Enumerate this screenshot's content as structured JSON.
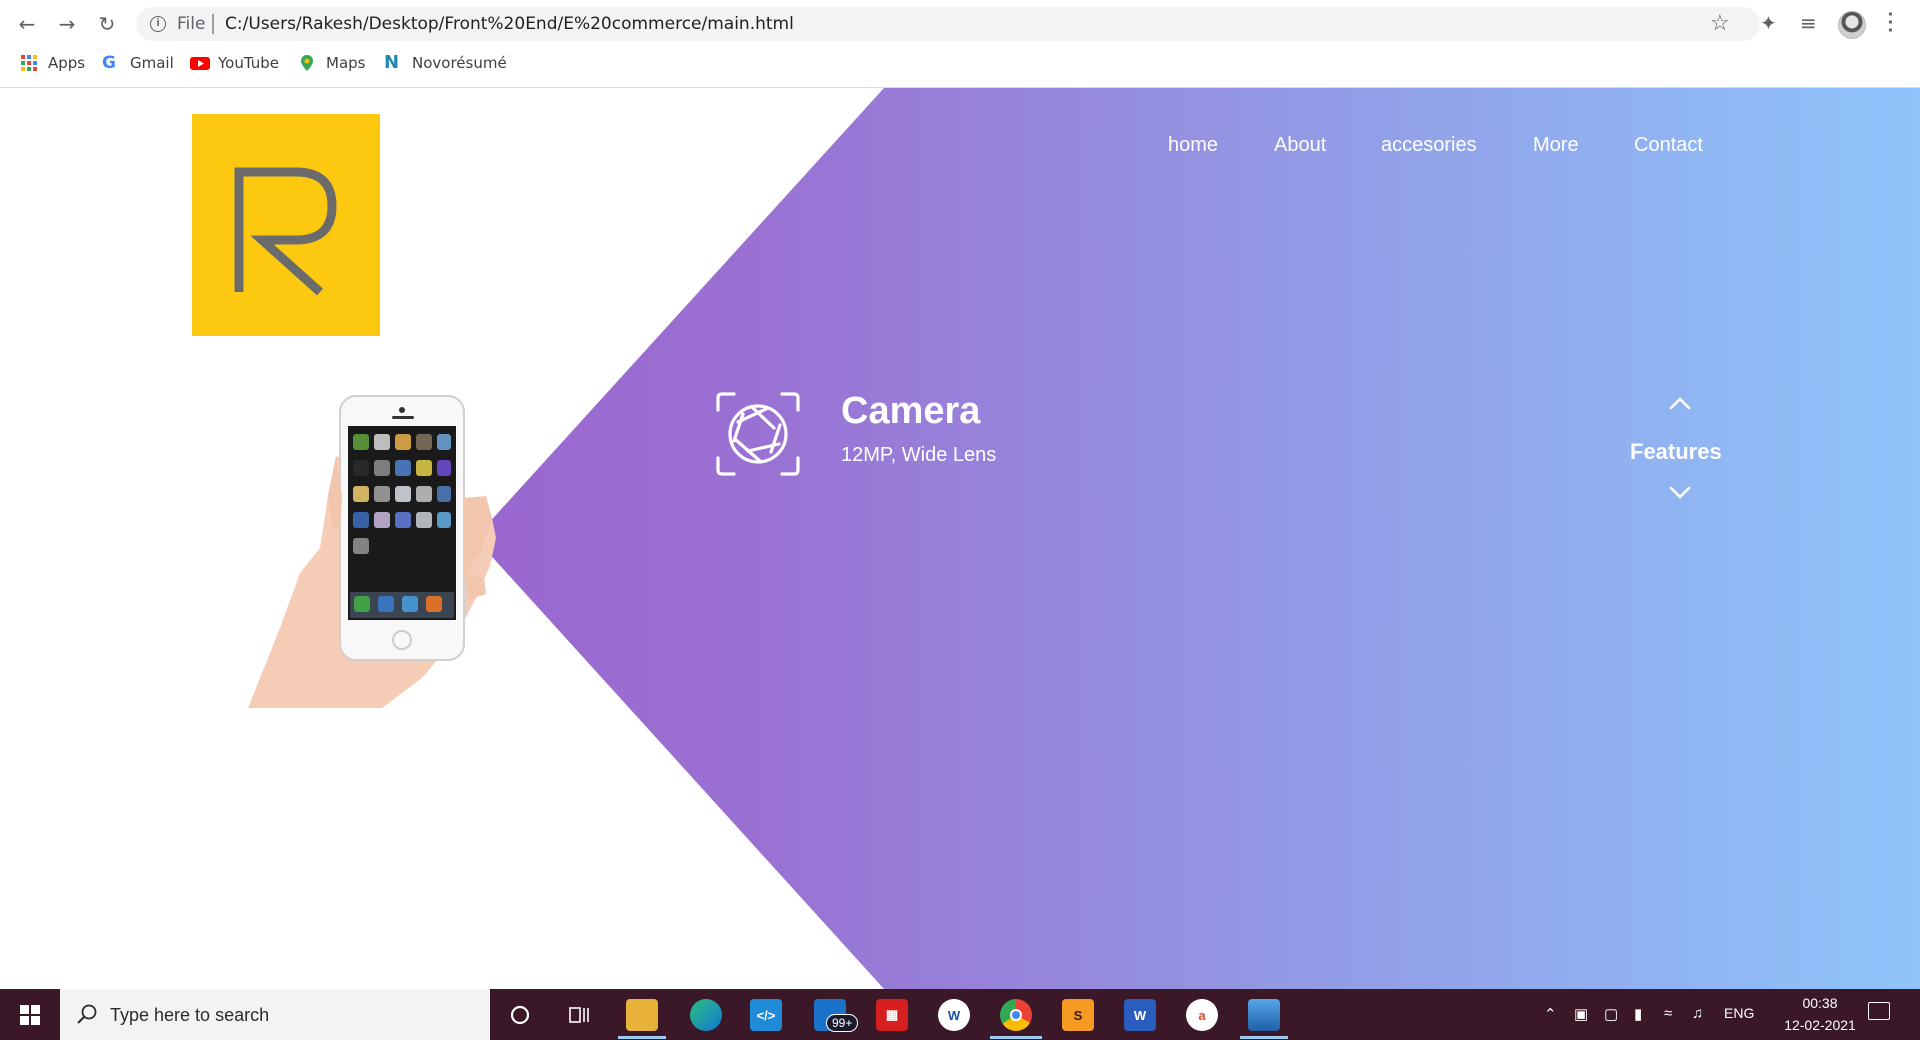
{
  "browser": {
    "file_label": "File",
    "url": "C:/Users/Rakesh/Desktop/Front%20End/E%20commerce/main.html",
    "bookmarks": [
      {
        "label": "Apps",
        "icon": "apps-grid-icon"
      },
      {
        "label": "Gmail",
        "icon": "google-icon"
      },
      {
        "label": "YouTube",
        "icon": "youtube-icon"
      },
      {
        "label": "Maps",
        "icon": "maps-pin-icon"
      },
      {
        "label": "Novorésumé",
        "icon": "novoresume-icon"
      }
    ]
  },
  "site": {
    "brand_color": "#fcc910",
    "nav": [
      "home",
      "About",
      "accesories",
      "More",
      "Contact"
    ],
    "feature": {
      "title": "Camera",
      "subtitle": "12MP, Wide Lens"
    },
    "features_label": "Features",
    "gradient": [
      "#9b59c9",
      "#8fc5fb"
    ]
  },
  "taskbar": {
    "search_placeholder": "Type here to search",
    "mail_badge": "99+",
    "language": "ENG",
    "time": "00:38",
    "date": "12-02-2021"
  }
}
